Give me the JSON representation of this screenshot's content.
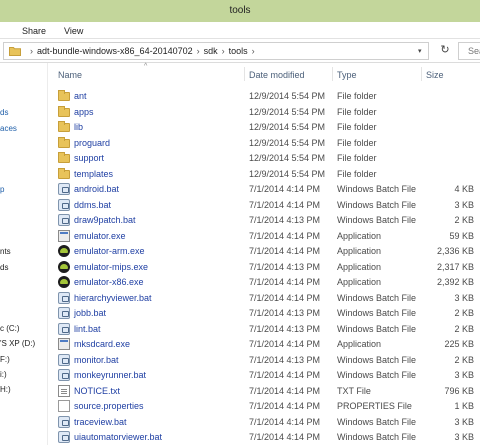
{
  "window": {
    "title": "tools"
  },
  "ribbon": {
    "tabs": [
      "Share",
      "View"
    ]
  },
  "address": {
    "path": [
      "adt-bundle-windows-x86_64-20140702",
      "sdk",
      "tools"
    ],
    "search_placeholder": "Sea"
  },
  "nav": {
    "items": [
      {
        "label": "ds",
        "color": "blue"
      },
      {
        "label": "aces",
        "color": "blue"
      },
      {
        "label": "p",
        "color": "blue"
      },
      {
        "label": "nts",
        "color": "dark"
      },
      {
        "label": "ds",
        "color": "dark"
      },
      {
        "label": "c (C:)",
        "color": "dark"
      },
      {
        "label": "'S XP (D:)",
        "color": "dark"
      },
      {
        "label": "F:)",
        "color": "dark"
      },
      {
        "label": "i:)",
        "color": "dark"
      },
      {
        "label": "H:)",
        "color": "dark"
      }
    ]
  },
  "columns": {
    "name": "Name",
    "date": "Date modified",
    "type": "Type",
    "size": "Size"
  },
  "files": [
    {
      "name": "ant",
      "date": "12/9/2014 5:54 PM",
      "type": "File folder",
      "size": "",
      "icon": "folder-icon"
    },
    {
      "name": "apps",
      "date": "12/9/2014 5:54 PM",
      "type": "File folder",
      "size": "",
      "icon": "folder-icon"
    },
    {
      "name": "lib",
      "date": "12/9/2014 5:54 PM",
      "type": "File folder",
      "size": "",
      "icon": "folder-icon"
    },
    {
      "name": "proguard",
      "date": "12/9/2014 5:54 PM",
      "type": "File folder",
      "size": "",
      "icon": "folder-icon"
    },
    {
      "name": "support",
      "date": "12/9/2014 5:54 PM",
      "type": "File folder",
      "size": "",
      "icon": "folder-icon"
    },
    {
      "name": "templates",
      "date": "12/9/2014 5:54 PM",
      "type": "File folder",
      "size": "",
      "icon": "folder-icon"
    },
    {
      "name": "android.bat",
      "date": "7/1/2014 4:14 PM",
      "type": "Windows Batch File",
      "size": "4 KB",
      "icon": "batch-file-icon"
    },
    {
      "name": "ddms.bat",
      "date": "7/1/2014 4:14 PM",
      "type": "Windows Batch File",
      "size": "3 KB",
      "icon": "batch-file-icon"
    },
    {
      "name": "draw9patch.bat",
      "date": "7/1/2014 4:13 PM",
      "type": "Windows Batch File",
      "size": "2 KB",
      "icon": "batch-file-icon"
    },
    {
      "name": "emulator.exe",
      "date": "7/1/2014 4:14 PM",
      "type": "Application",
      "size": "59 KB",
      "icon": "application-icon"
    },
    {
      "name": "emulator-arm.exe",
      "date": "7/1/2014 4:14 PM",
      "type": "Application",
      "size": "2,336 KB",
      "icon": "android-emulator-icon"
    },
    {
      "name": "emulator-mips.exe",
      "date": "7/1/2014 4:13 PM",
      "type": "Application",
      "size": "2,317 KB",
      "icon": "android-emulator-icon"
    },
    {
      "name": "emulator-x86.exe",
      "date": "7/1/2014 4:14 PM",
      "type": "Application",
      "size": "2,392 KB",
      "icon": "android-emulator-icon"
    },
    {
      "name": "hierarchyviewer.bat",
      "date": "7/1/2014 4:14 PM",
      "type": "Windows Batch File",
      "size": "3 KB",
      "icon": "batch-file-icon"
    },
    {
      "name": "jobb.bat",
      "date": "7/1/2014 4:13 PM",
      "type": "Windows Batch File",
      "size": "2 KB",
      "icon": "batch-file-icon"
    },
    {
      "name": "lint.bat",
      "date": "7/1/2014 4:13 PM",
      "type": "Windows Batch File",
      "size": "2 KB",
      "icon": "batch-file-icon"
    },
    {
      "name": "mksdcard.exe",
      "date": "7/1/2014 4:14 PM",
      "type": "Application",
      "size": "225 KB",
      "icon": "application-icon"
    },
    {
      "name": "monitor.bat",
      "date": "7/1/2014 4:13 PM",
      "type": "Windows Batch File",
      "size": "2 KB",
      "icon": "batch-file-icon"
    },
    {
      "name": "monkeyrunner.bat",
      "date": "7/1/2014 4:14 PM",
      "type": "Windows Batch File",
      "size": "3 KB",
      "icon": "batch-file-icon"
    },
    {
      "name": "NOTICE.txt",
      "date": "7/1/2014 4:14 PM",
      "type": "TXT File",
      "size": "796 KB",
      "icon": "text-file-icon"
    },
    {
      "name": "source.properties",
      "date": "7/1/2014 4:14 PM",
      "type": "PROPERTIES File",
      "size": "1 KB",
      "icon": "generic-file-icon"
    },
    {
      "name": "traceview.bat",
      "date": "7/1/2014 4:14 PM",
      "type": "Windows Batch File",
      "size": "3 KB",
      "icon": "batch-file-icon"
    },
    {
      "name": "uiautomatorviewer.bat",
      "date": "7/1/2014 4:14 PM",
      "type": "Windows Batch File",
      "size": "3 KB",
      "icon": "batch-file-icon"
    }
  ],
  "colors": {
    "titlebar": "#c3d69b",
    "link": "#1f3fa3",
    "header": "#4c607a"
  }
}
